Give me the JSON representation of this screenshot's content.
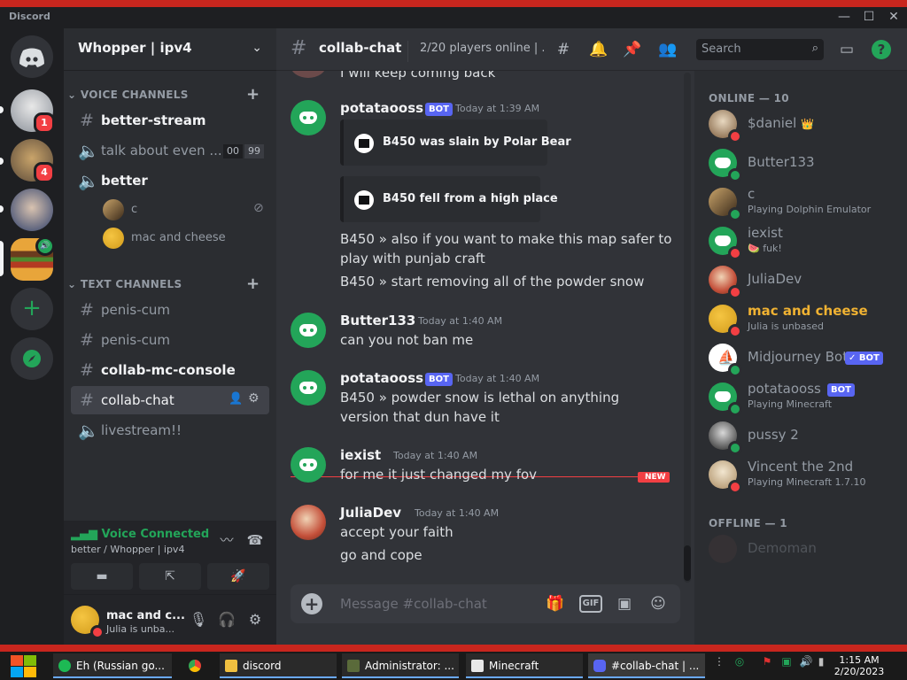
{
  "window": {
    "app_name": "Discord",
    "minimize": "—",
    "maximize": "☐",
    "close": "✕"
  },
  "guild": {
    "name": "Whopper | ipv4",
    "badges": [
      "1",
      "4"
    ]
  },
  "categories": {
    "voice": "VOICE CHANNELS",
    "text": "TEXT CHANNELS"
  },
  "voice_channels": [
    {
      "label": "better-stream",
      "icon": "#"
    },
    {
      "label": "talk about even ...",
      "icon": "🔈",
      "tag_a": "00",
      "tag_b": "99"
    },
    {
      "label": "better",
      "icon": "🔈"
    }
  ],
  "voice_users": [
    {
      "name": "c"
    },
    {
      "name": "mac and cheese"
    }
  ],
  "text_channels": [
    {
      "label": "penis-cum"
    },
    {
      "label": "penis-cum"
    },
    {
      "label": "collab-mc-console"
    },
    {
      "label": "collab-chat"
    },
    {
      "label": "livestream!!"
    }
  ],
  "voice_panel": {
    "status": "Voice Connected",
    "location": "better / Whopper | ipv4"
  },
  "user_panel": {
    "name": "mac and c...",
    "status": "Julia is unba..."
  },
  "chat_header": {
    "channel": "collab-chat",
    "topic": "2/20 players online | ...",
    "search_placeholder": "Search"
  },
  "messages": {
    "partial": "I will keep coming back",
    "m1": {
      "author": "potataooss",
      "bot": "BOT",
      "time": "Today at 1:39 AM",
      "embed1": "B450 was slain by Polar Bear",
      "embed2": "B450 fell from a high place",
      "line1": "B450 » also if you want to make this map safer to",
      "line2": "play with punjab craft",
      "line3": "B450 » start removing all of the powder snow"
    },
    "m2": {
      "author": "Butter133",
      "time": "Today at 1:40 AM",
      "line1": "can you not ban me"
    },
    "m3": {
      "author": "potataooss",
      "bot": "BOT",
      "time": "Today at 1:40 AM",
      "line1": "B450 » powder snow is lethal on anything",
      "line2": "version that dun have it"
    },
    "new_label": "NEW",
    "m4": {
      "author": "iexist",
      "time": "Today at 1:40 AM",
      "line1": "for me it just changed my fov"
    },
    "m5": {
      "author": "JuliaDev",
      "time": "Today at 1:40 AM",
      "line1": "accept your faith",
      "line2": "go and cope"
    }
  },
  "composer": {
    "placeholder": "Message #collab-chat",
    "gif": "GIF"
  },
  "members": {
    "online_header": "ONLINE — 10",
    "offline_header": "OFFLINE — 1",
    "online": [
      {
        "name": "$daniel",
        "suffix": "👑",
        "status": "",
        "color": "#949ba4",
        "presence": "#f23f43"
      },
      {
        "name": "Butter133",
        "status": "",
        "color": "#949ba4",
        "presence": "#23a559"
      },
      {
        "name": "c",
        "status": "Playing Dolphin Emulator",
        "color": "#949ba4",
        "presence": "#23a559"
      },
      {
        "name": "iexist",
        "status": "🍉 fuk!",
        "color": "#949ba4",
        "presence": "#f23f43"
      },
      {
        "name": "JuliaDev",
        "status": "",
        "color": "#949ba4",
        "presence": "#f23f43"
      },
      {
        "name": "mac and cheese",
        "status": "Julia is unbased",
        "color": "#f0b232",
        "presence": "#f23f43"
      },
      {
        "name": "Midjourney Bot",
        "bot": "✓ BOT",
        "status": "",
        "color": "#949ba4",
        "presence": "#23a559"
      },
      {
        "name": "potataooss",
        "bot": "BOT",
        "status": "Playing Minecraft",
        "color": "#949ba4",
        "presence": "#23a559"
      },
      {
        "name": "pussy 2",
        "status": "",
        "color": "#949ba4",
        "presence": "#23a559"
      },
      {
        "name": "Vincent the 2nd",
        "status": "Playing Minecraft 1.7.10",
        "color": "#949ba4",
        "presence": "#f23f43"
      }
    ],
    "offline": [
      {
        "name": "Demoman"
      }
    ]
  },
  "taskbar": {
    "items": [
      {
        "label": "Eh (Russian go..."
      },
      {
        "label": ""
      },
      {
        "label": "discord"
      },
      {
        "label": "Administrator: ..."
      },
      {
        "label": "Minecraft"
      },
      {
        "label": "#collab-chat | ..."
      }
    ],
    "time": "1:15 AM",
    "date": "2/20/2023"
  },
  "colors": {
    "accent": "#5865f2",
    "online": "#23a559",
    "dnd": "#f23f43",
    "mention": "#f0b232"
  }
}
